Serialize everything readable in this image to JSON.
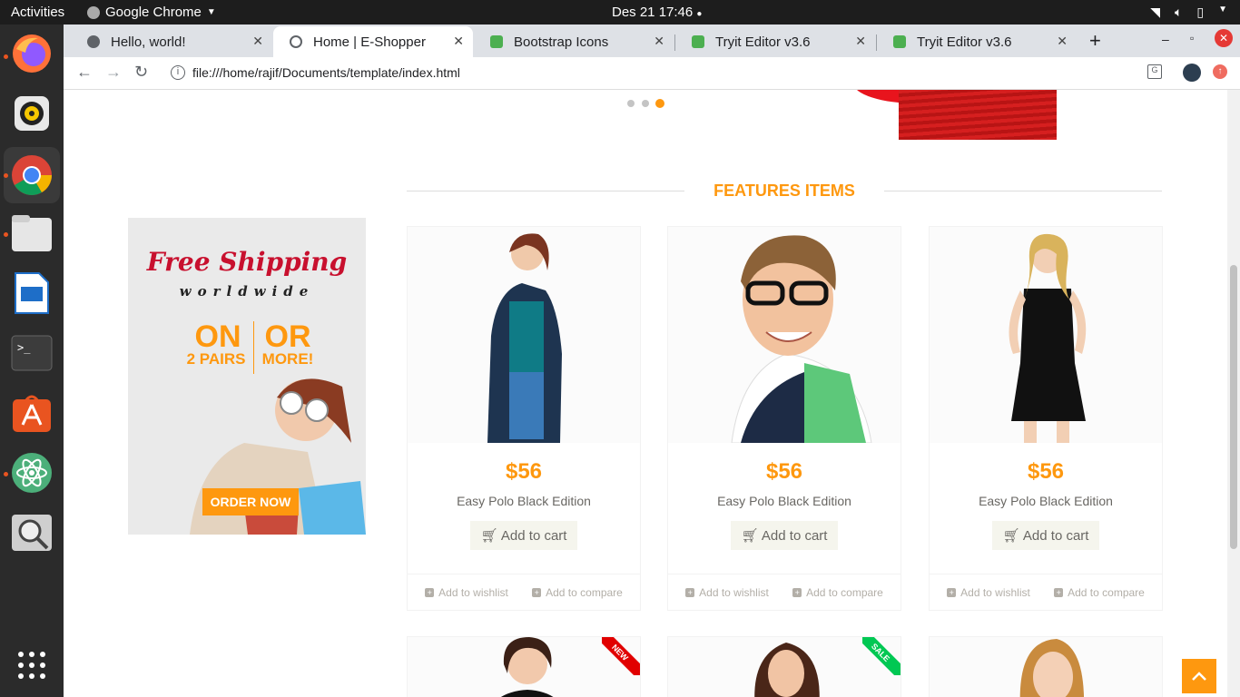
{
  "system": {
    "activities": "Activities",
    "app_name": "Google Chrome",
    "clock": "Des 21  17:46"
  },
  "tabs": [
    {
      "title": "Hello, world!",
      "color": "#5f6368"
    },
    {
      "title": "Home | E-Shopper",
      "color": "#5f6368"
    },
    {
      "title": "Bootstrap Icons",
      "color": "#4caf50"
    },
    {
      "title": "Tryit Editor v3.6",
      "color": "#4caf50"
    },
    {
      "title": "Tryit Editor v3.6",
      "color": "#4caf50"
    }
  ],
  "address": {
    "url": "file:///home/rajif/Documents/template/index.html"
  },
  "section": {
    "title": "FEATURES ITEMS"
  },
  "banner": {
    "headline": "Free Shipping",
    "sub": "worldwide",
    "on": "ON",
    "or": "OR",
    "pairs": "2 PAIRS",
    "more": "MORE!",
    "cta": "ORDER NOW"
  },
  "products": [
    {
      "price": "$56",
      "name": "Easy Polo Black Edition",
      "cart": "Add to cart",
      "wishlist": "Add to wishlist",
      "compare": "Add to compare"
    },
    {
      "price": "$56",
      "name": "Easy Polo Black Edition",
      "cart": "Add to cart",
      "wishlist": "Add to wishlist",
      "compare": "Add to compare"
    },
    {
      "price": "$56",
      "name": "Easy Polo Black Edition",
      "cart": "Add to cart",
      "wishlist": "Add to wishlist",
      "compare": "Add to compare"
    }
  ],
  "ribbons": {
    "new": "NEW",
    "sale": "SALE"
  },
  "colors": {
    "accent": "#fe980f",
    "ribbon_new": "#e10000",
    "ribbon_sale": "#00c853"
  }
}
